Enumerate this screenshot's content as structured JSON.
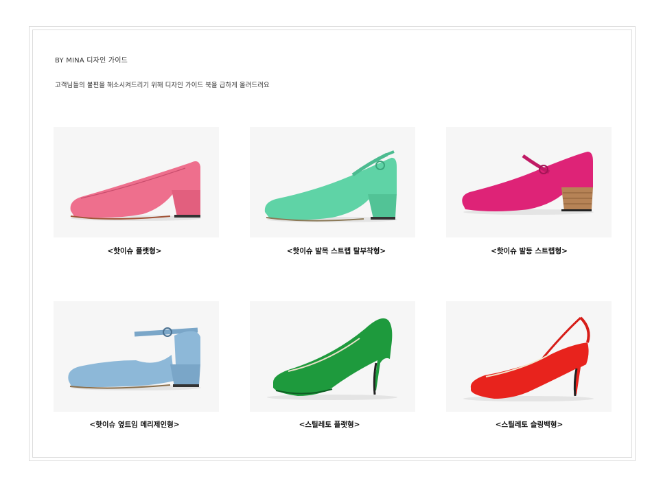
{
  "header": {
    "title": "BY MINA 디자인 가이드",
    "subtitle": "고객님들의 불편을 해소시켜드리기 위해 디자인 가이드 북을 급하게 올려드려요"
  },
  "products": [
    {
      "caption": "<핫이슈 플랫형>",
      "color": "#ee6f8d"
    },
    {
      "caption": "<핫이슈 발목 스트랩 탈부착형>",
      "color": "#5fd3a6"
    },
    {
      "caption": "<핫이슈 발등 스트랩형>",
      "color": "#de2377"
    },
    {
      "caption": "<핫이슈 옆트임 메리제인형>",
      "color": "#8db8d8"
    },
    {
      "caption": "<스틸레토 플랫형>",
      "color": "#1e9a3d"
    },
    {
      "caption": "<스틸레토 슬링백형>",
      "color": "#e8231d"
    }
  ]
}
